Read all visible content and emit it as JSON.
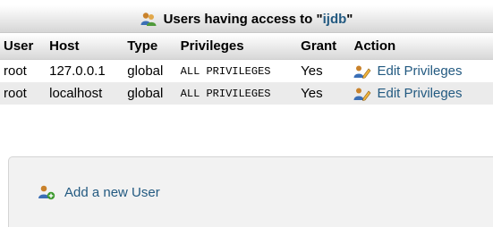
{
  "title": {
    "prefix": "Users having access to ",
    "db_name": "ijdb",
    "open_quote": "\"",
    "close_quote": "\""
  },
  "table": {
    "headers": [
      "User",
      "Host",
      "Type",
      "Privileges",
      "Grant",
      "Action"
    ],
    "rows": [
      {
        "user": "root",
        "host": "127.0.0.1",
        "type": "global",
        "privileges": "ALL PRIVILEGES",
        "grant": "Yes",
        "action": "Edit Privileges"
      },
      {
        "user": "root",
        "host": "localhost",
        "type": "global",
        "privileges": "ALL PRIVILEGES",
        "grant": "Yes",
        "action": "Edit Privileges"
      }
    ]
  },
  "add_user": {
    "label": "Add a new User"
  },
  "icons": {
    "title": "users-icon",
    "edit": "edit-privileges-icon",
    "add": "add-user-icon"
  },
  "colors": {
    "link": "#235a81",
    "row_alt": "#ebebeb"
  }
}
